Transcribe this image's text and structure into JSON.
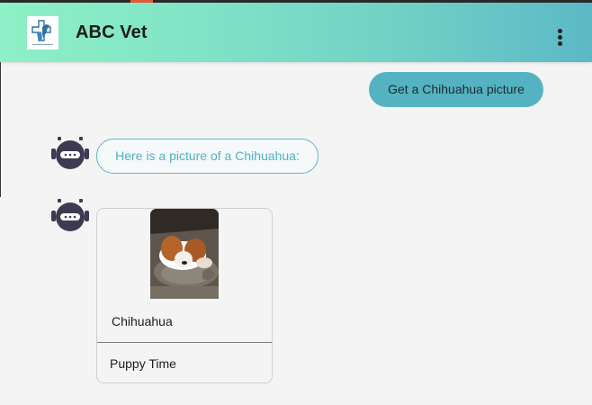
{
  "header": {
    "title": "ABC Vet",
    "logo_icon": "vet-cross-logo",
    "menu_icon": "more-vert-icon",
    "gradient": [
      "#8ef0c6",
      "#5bb9c6"
    ]
  },
  "chat": {
    "user_message": "Get a Chihuahua picture",
    "bot_avatar_icon": "robot-icon",
    "bot_message": "Here is a picture of a Chihuahua:",
    "card": {
      "image_alt": "dog-photo",
      "title": "Chihuahua",
      "action_label": "Puppy Time"
    }
  },
  "colors": {
    "accent": "#55b3c1",
    "avatar": "#3d3b52"
  }
}
